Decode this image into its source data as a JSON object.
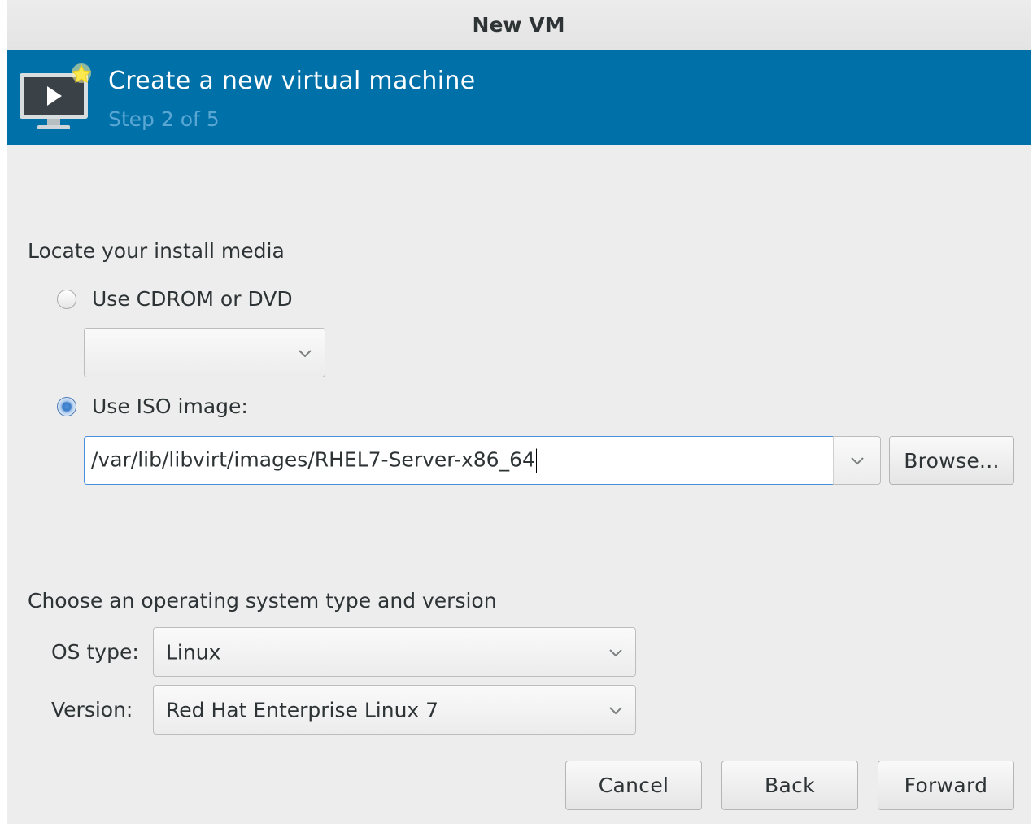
{
  "window": {
    "title": "New VM"
  },
  "header": {
    "title": "Create a new virtual machine",
    "step": "Step 2 of 5",
    "icon": "virtual-machine-new-icon"
  },
  "install_media": {
    "heading": "Locate your install media",
    "cdrom": {
      "label": "Use CDROM or DVD",
      "selected": false,
      "value": ""
    },
    "iso": {
      "label": "Use ISO image:",
      "selected": true,
      "path": "/var/lib/libvirt/images/RHEL7-Server-x86_64",
      "browse_label": "Browse..."
    }
  },
  "os": {
    "heading": "Choose an operating system type and version",
    "type_label": "OS type:",
    "type_value": "Linux",
    "version_label": "Version:",
    "version_value": "Red Hat Enterprise Linux 7"
  },
  "buttons": {
    "cancel": "Cancel",
    "back": "Back",
    "forward": "Forward"
  },
  "colors": {
    "banner": "#0070a8",
    "subtitle": "#5aa7d4",
    "focus": "#4a90d9"
  }
}
